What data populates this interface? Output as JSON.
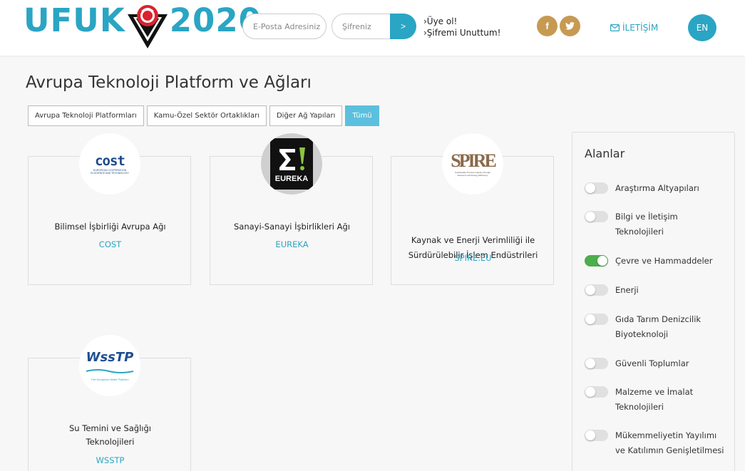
{
  "header": {
    "logo_left": "UFUK",
    "logo_right": "2020",
    "email_placeholder": "E-Posta Adresiniz",
    "password_placeholder": "Şifreniz",
    "login_button": ">",
    "register_link": "›Üye ol!",
    "forgot_link": "›Şifremi Unuttum!",
    "facebook": "f",
    "twitter": "t",
    "contact_label": "İLETİŞİM",
    "language": "EN"
  },
  "page": {
    "title": "Avrupa Teknoloji Platform ve Ağları"
  },
  "filters": [
    {
      "label": "Avrupa Teknoloji Platformları"
    },
    {
      "label": "Kamu-Özel Sektör Ortaklıkları"
    },
    {
      "label": "Diğer Ağ Yapıları"
    },
    {
      "label": "Tümü",
      "active": true
    }
  ],
  "cards": [
    {
      "name_line1": "Bilimsel İşbirliği Avrupa Ağı",
      "name_line2": "",
      "code": "COST",
      "logo_word": "cost",
      "logo_sub1": "EUROPEAN COOPERATION",
      "logo_sub2": "IN SCIENCE AND TECHNOLOGY"
    },
    {
      "name_line1": "Sanayi-Sanayi İşbirlikleri Ağı",
      "name_line2": "",
      "code": "EUREKA",
      "logo_word": "EUREKA"
    },
    {
      "name_line1": "Kaynak ve Enerji Verimliliği ile",
      "name_line2": "Sürdürülebilir İşlem Endüstrileri",
      "code": "SPIRE.EU",
      "logo_word": "SPIRE",
      "logo_sub1": "Sustainable Process Industry through",
      "logo_sub2": "Resource and Energy Efficiency"
    },
    {
      "name_line1": "Su Temini ve Sağlığı",
      "name_line2": "Teknolojileri",
      "code": "WSSTP",
      "logo_word": "WssTP",
      "logo_sub1": "The European Water Platform"
    }
  ],
  "sidebar": {
    "title": "Alanlar",
    "items": [
      {
        "line1": "Araştırma Altyapıları",
        "line2": "",
        "on": false
      },
      {
        "line1": "Bilgi ve İletişim",
        "line2": "Teknolojileri",
        "on": false
      },
      {
        "line1": "Çevre ve Hammaddeler",
        "line2": "",
        "on": true
      },
      {
        "line1": "Enerji",
        "line2": "",
        "on": false
      },
      {
        "line1": "Gıda Tarım Denizcilik",
        "line2": "Biyoteknoloji",
        "on": false
      },
      {
        "line1": "Güvenli Toplumlar",
        "line2": "",
        "on": false
      },
      {
        "line1": "Malzeme ve İmalat",
        "line2": "Teknolojileri",
        "on": false
      },
      {
        "line1": "Mükemmeliyetin Yayılımı",
        "line2": "ve Katılımın Genişletilmesi",
        "on": false
      }
    ]
  },
  "colors": {
    "accent": "#2aa5c4",
    "toggle_on": "#4cae4c",
    "social": "#c79a52"
  }
}
